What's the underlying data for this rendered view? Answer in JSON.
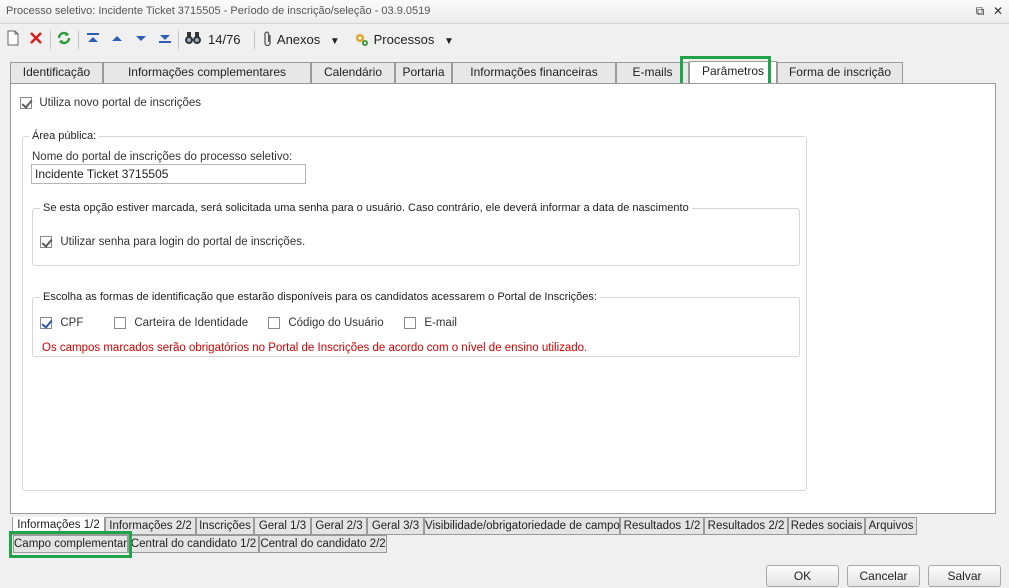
{
  "window": {
    "title": "Processo seletivo: Incidente Ticket 3715505 - Período de inscrição/seleção - 03.9.0519"
  },
  "toolbar": {
    "record_counter": "14/76",
    "anexos_label": "Anexos",
    "processos_label": "Processos"
  },
  "tabs_top": [
    {
      "label": "Identificação"
    },
    {
      "label": "Informações complementares"
    },
    {
      "label": "Calendário"
    },
    {
      "label": "Portaria"
    },
    {
      "label": "Informações financeiras"
    },
    {
      "label": "E-mails"
    },
    {
      "label": "Parâmetros"
    },
    {
      "label": "Forma de inscrição"
    }
  ],
  "panel": {
    "novo_portal_label": "Utiliza novo portal de inscrições",
    "area_publica_label": "Área pública:",
    "nome_portal_label": "Nome do portal de inscrições do processo seletivo:",
    "nome_portal_value": "Incidente Ticket 3715505",
    "senha_group_label": "Se esta opção estiver marcada, será solicitada uma senha para o usuário. Caso contrário, ele deverá informar a data de nascimento",
    "senha_checkbox_label": "Utilizar senha para login do portal de inscrições.",
    "identificacao_group_label": "Escolha as formas de identificação que estarão disponíveis para os candidatos acessarem o Portal de Inscrições:",
    "cpf_label": "CPF",
    "carteira_label": "Carteira de Identidade",
    "codigo_label": "Código do Usuário",
    "email_label": "E-mail",
    "warning_text": "Os campos marcados serão obrigatórios no Portal de Inscrições de acordo com o nível de ensino utilizado."
  },
  "tabs_bottom_row1": [
    {
      "label": "Informações 1/2"
    },
    {
      "label": "Informações 2/2"
    },
    {
      "label": "Inscrições"
    },
    {
      "label": "Geral 1/3"
    },
    {
      "label": "Geral 2/3"
    },
    {
      "label": "Geral 3/3"
    },
    {
      "label": "Visibilidade/obrigatoriedade de campos"
    },
    {
      "label": "Resultados 1/2"
    },
    {
      "label": "Resultados 2/2"
    },
    {
      "label": "Redes sociais"
    },
    {
      "label": "Arquivos"
    }
  ],
  "tabs_bottom_row2": [
    {
      "label": "Campo complementar"
    },
    {
      "label": "Central do candidato 1/2"
    },
    {
      "label": "Central do candidato 2/2"
    }
  ],
  "buttons": {
    "ok": "OK",
    "cancelar": "Cancelar",
    "salvar": "Salvar"
  },
  "colors": {
    "highlight": "#22a34a",
    "warning": "#d00000"
  }
}
